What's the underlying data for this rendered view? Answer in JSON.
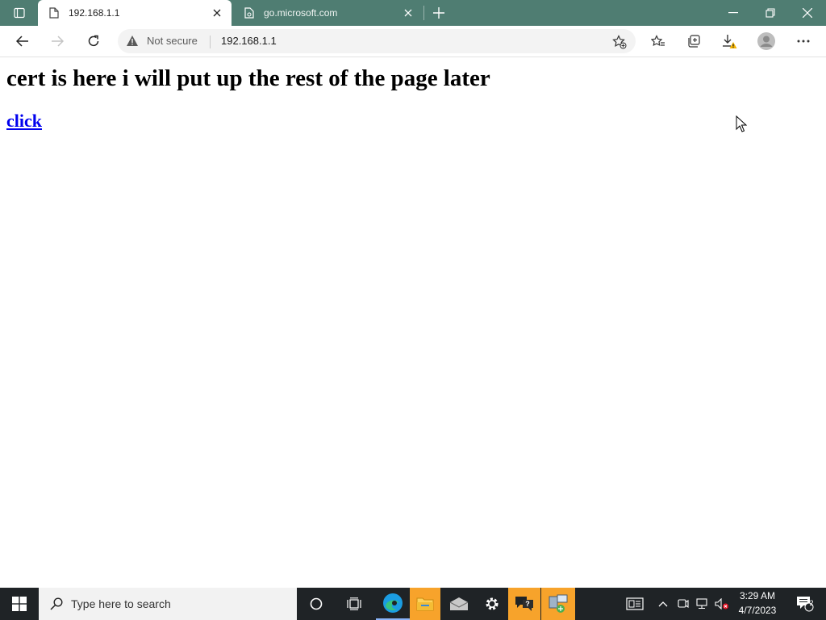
{
  "browser": {
    "tabs": [
      {
        "title": "192.168.1.1",
        "active": true
      },
      {
        "title": "go.microsoft.com",
        "active": false
      }
    ],
    "address_bar": {
      "security_label": "Not secure",
      "url": "192.168.1.1"
    }
  },
  "page": {
    "heading": "cert is here i will put up the rest of the page later",
    "link_text": "click"
  },
  "taskbar": {
    "search_placeholder": "Type here to search",
    "time": "3:29 AM",
    "date": "4/7/2023",
    "notification_count": "2"
  },
  "colors": {
    "titlebar": "#4f7d72",
    "taskbar": "#1f2326",
    "link": "#0000ee",
    "warning": "#f5b400"
  }
}
